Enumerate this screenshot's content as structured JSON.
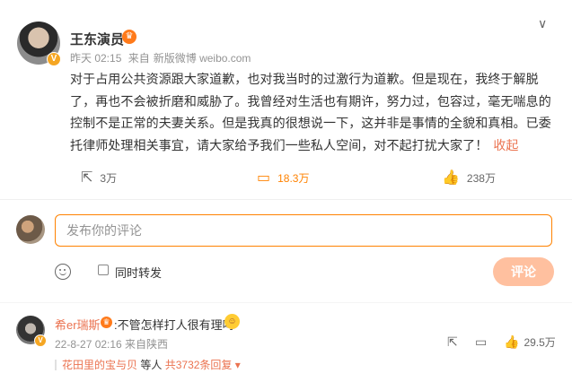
{
  "post": {
    "author": "王东演员",
    "author_badge": "crown-icon",
    "time": "昨天 02:15",
    "source_prefix": "来自",
    "source": "新版微博 weibo.com",
    "content": "对于占用公共资源跟大家道歉，也对我当时的过激行为道歉。但是现在，我终于解脱了，再也不会被折磨和威胁了。我曾经对生活也有期许，努力过，包容过，毫无喘息的控制不是正常的夫妻关系。但是我真的很想说一下，这并非是事情的全貌和真相。已委托律师处理相关事宜，请大家给予我们一些私人空间，对不起打扰大家了！",
    "collapse_label": "收起",
    "forward_count": "3万",
    "comment_count": "18.3万",
    "like_count": "238万"
  },
  "composer": {
    "placeholder": "发布你的评论",
    "repost_label": "同时转发",
    "submit_label": "评论"
  },
  "comments": [
    {
      "author": "希er瑞斯",
      "text": ":不管怎样打人很有理吗",
      "meta": "22-8-27 02:16 来自陕西",
      "like_count": "29.5万",
      "reply_name": "花田里的宝与贝",
      "reply_suffix": "等人",
      "reply_more": "共3732条回复"
    }
  ],
  "colors": {
    "accent": "#ff8200",
    "link": "#eb7350",
    "submit_disabled": "#ffc09f"
  }
}
